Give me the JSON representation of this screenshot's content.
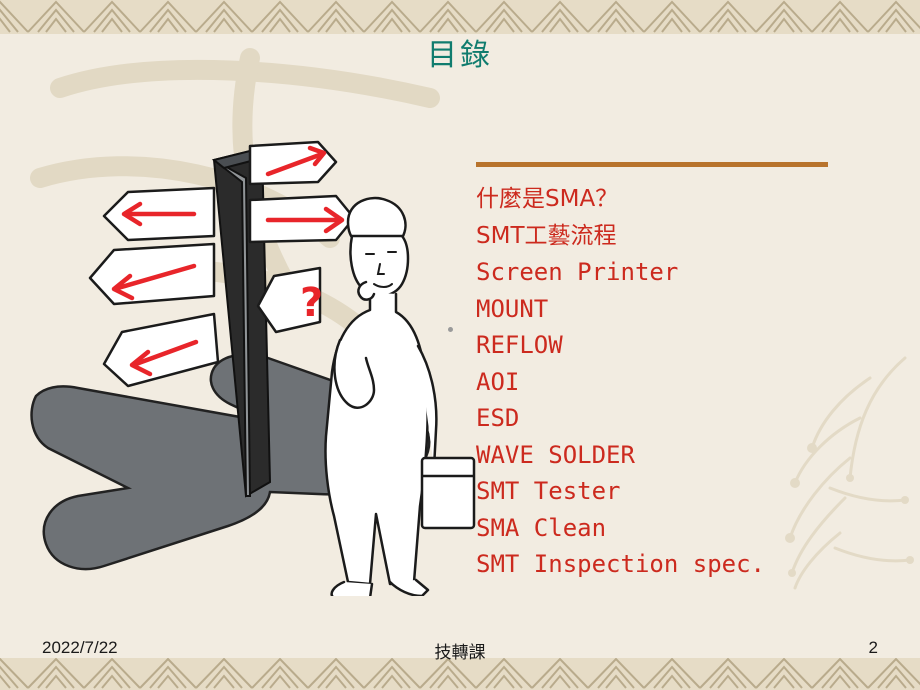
{
  "slide": {
    "title": "目錄",
    "title_color": "#107c6e",
    "background_color": "#f2ece1",
    "border_band_color": "#e6dcc6",
    "rule_color": "#b8732c",
    "list_text_color": "#cc2a1e",
    "contents": [
      "什麼是SMA？",
      "SMT工藝流程",
      "Screen Printer",
      "MOUNT",
      "REFLOW",
      "AOI",
      "ESD",
      "WAVE SOLDER",
      "SMT Tester",
      "SMA Clean",
      "SMT Inspection spec."
    ],
    "artwork_alt": "signpost-and-person-illustration"
  },
  "footer": {
    "date": "2022/7/22",
    "center": "技轉課",
    "page_number": "2"
  }
}
